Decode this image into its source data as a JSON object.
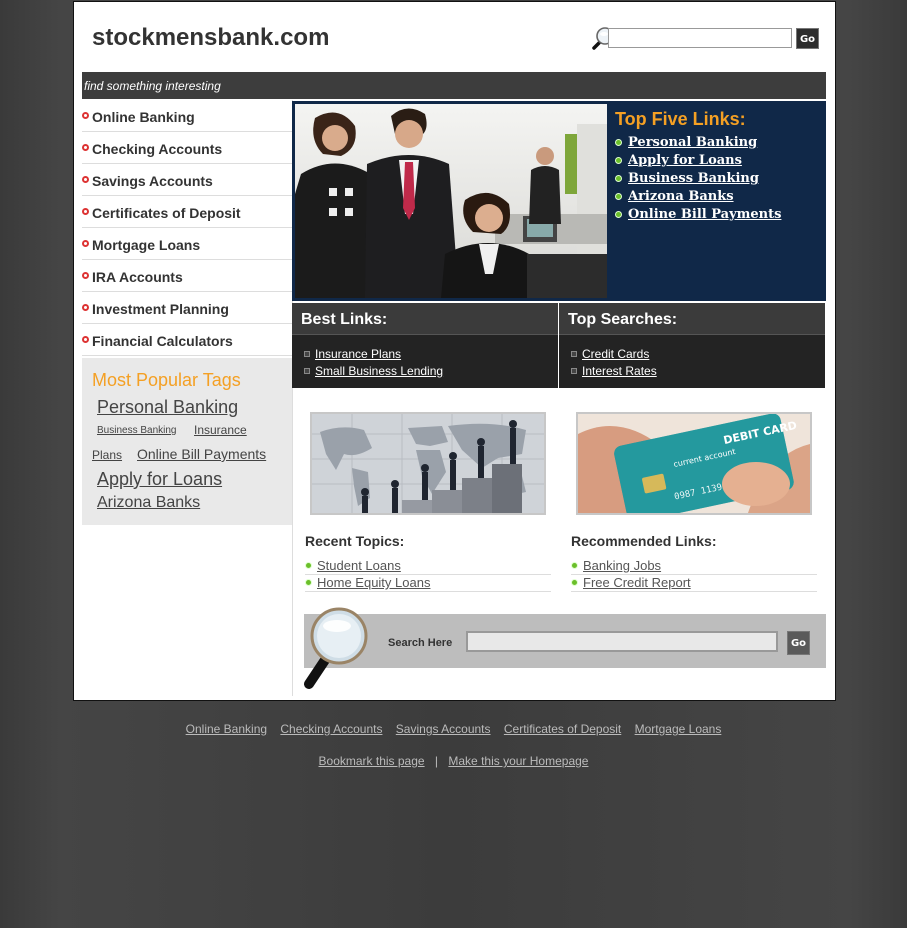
{
  "site_title": "stockmensbank.com",
  "header_search": {
    "value": "",
    "go_label": "Go"
  },
  "tagline": "find something interesting",
  "sidebar": {
    "items": [
      {
        "label": "Online Banking"
      },
      {
        "label": "Checking Accounts"
      },
      {
        "label": "Savings Accounts"
      },
      {
        "label": "Certificates of Deposit"
      },
      {
        "label": "Mortgage Loans"
      },
      {
        "label": "IRA Accounts"
      },
      {
        "label": "Investment Planning"
      },
      {
        "label": "Financial Calculators"
      }
    ]
  },
  "popular_tags": {
    "title": "Most Popular Tags",
    "tags": [
      {
        "label": "Personal Banking"
      },
      {
        "label": "Business Banking"
      },
      {
        "label": "Insurance"
      },
      {
        "label": "Plans"
      },
      {
        "label": "Online Bill Payments"
      },
      {
        "label": "Apply for Loans"
      },
      {
        "label": "Arizona Banks"
      }
    ]
  },
  "top_five": {
    "title": "Top Five Links:",
    "links": [
      {
        "label": "Personal Banking"
      },
      {
        "label": "Apply for Loans"
      },
      {
        "label": "Business Banking"
      },
      {
        "label": "Arizona Banks"
      },
      {
        "label": "Online Bill Payments"
      }
    ]
  },
  "best_links": {
    "title": "Best Links:",
    "links": [
      {
        "label": "Insurance Plans"
      },
      {
        "label": "Small Business Lending"
      }
    ]
  },
  "top_searches": {
    "title": "Top Searches:",
    "links": [
      {
        "label": "Credit Cards"
      },
      {
        "label": "Interest Rates"
      }
    ]
  },
  "card_image_text": {
    "top": "DEBIT CARD",
    "mid": "current account",
    "num": "0987 1139 987"
  },
  "recent_topics": {
    "title": "Recent Topics:",
    "links": [
      {
        "label": "Student Loans"
      },
      {
        "label": "Home Equity Loans"
      }
    ]
  },
  "recommended_links": {
    "title": "Recommended Links:",
    "links": [
      {
        "label": "Banking Jobs"
      },
      {
        "label": "Free Credit Report"
      }
    ]
  },
  "bottom_search": {
    "label": "Search Here",
    "value": "",
    "go_label": "Go"
  },
  "footer": {
    "links": [
      {
        "label": "Online Banking"
      },
      {
        "label": "Checking Accounts"
      },
      {
        "label": "Savings Accounts"
      },
      {
        "label": "Certificates of Deposit"
      },
      {
        "label": "Mortgage Loans"
      }
    ],
    "bookmark_label": "Bookmark this page",
    "separator": "|",
    "homepage_label": "Make this your Homepage"
  },
  "colors": {
    "accent_orange": "#f4a024",
    "hero_navy": "#102848",
    "bullet_red": "#dd3333",
    "bullet_green": "#6bbf2a",
    "band_dark": "#232323"
  }
}
